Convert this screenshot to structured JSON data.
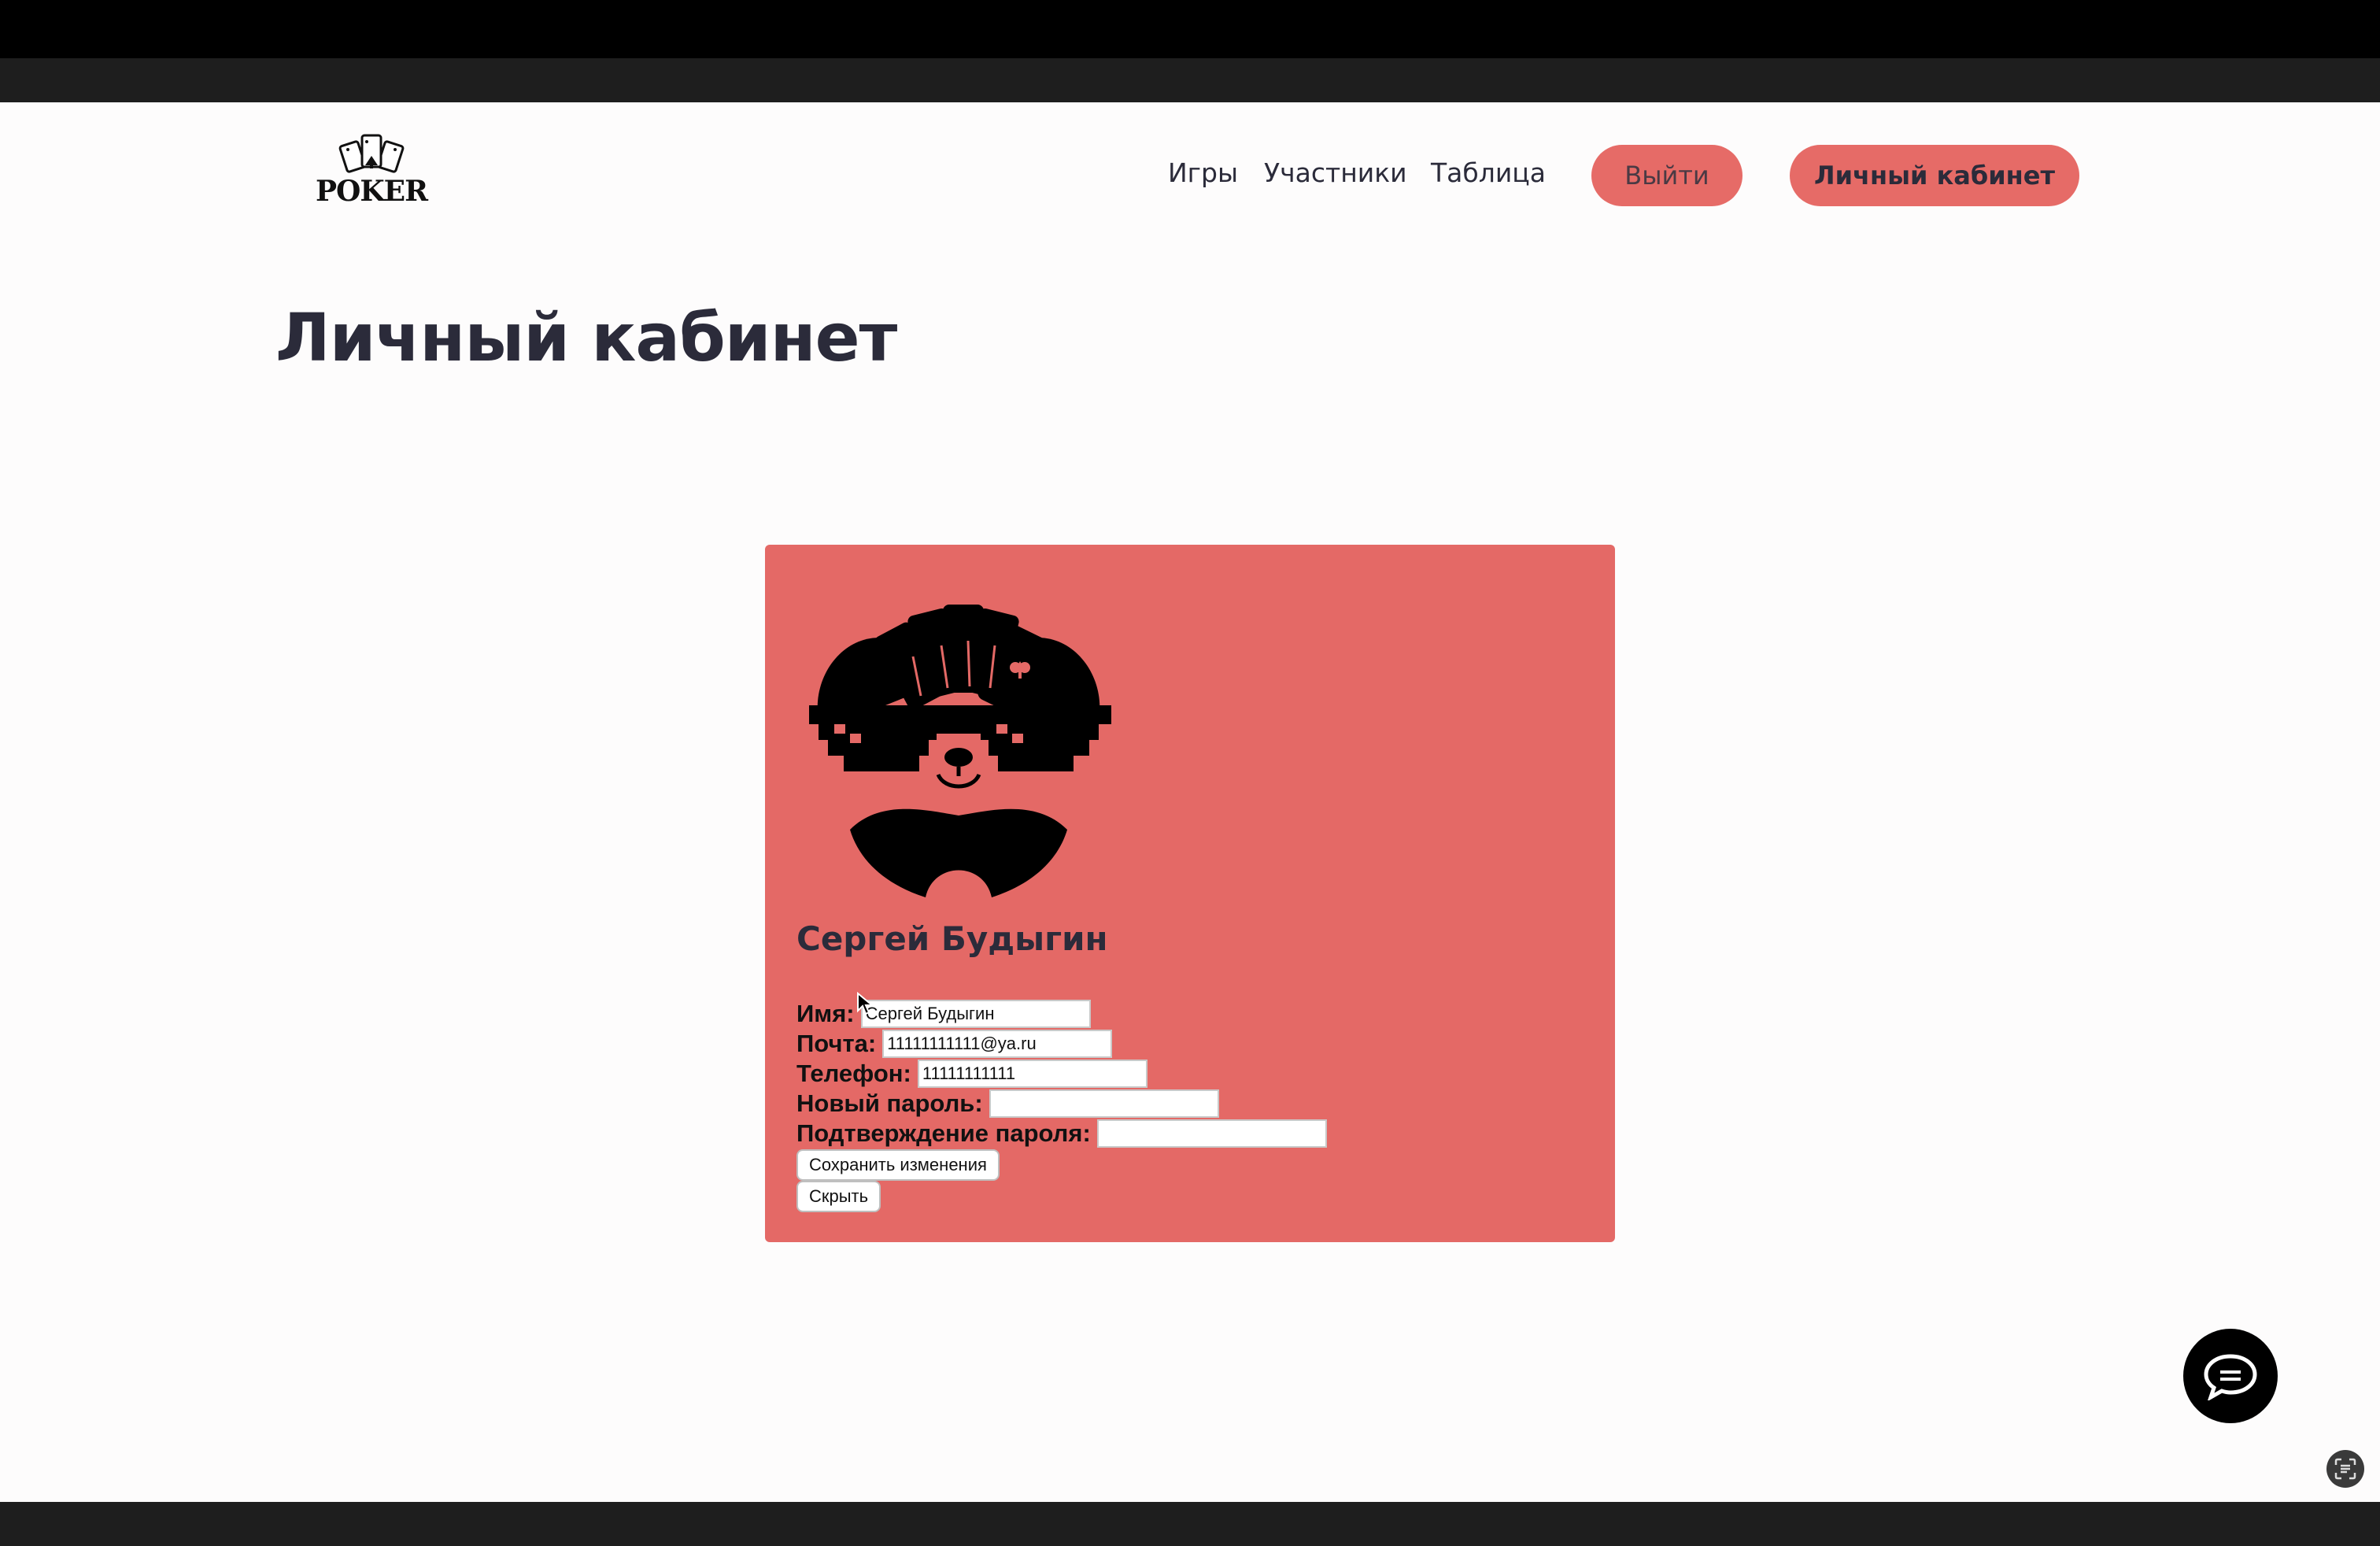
{
  "header": {
    "logo_text": "POKER",
    "nav": {
      "games": "Игры",
      "participants": "Участники",
      "table": "Таблица",
      "logout": "Выйти",
      "cabinet": "Личный кабинет"
    }
  },
  "page": {
    "title": "Личный кабинет"
  },
  "profile": {
    "display_name": "Сергей Будыгин",
    "fields": {
      "name_label": "Имя:",
      "name_value": "Сергей Будыгин",
      "email_label": "Почта:",
      "email_value": "11111111111@ya.ru",
      "phone_label": "Телефон:",
      "phone_value": "11111111111",
      "new_password_label": "Новый пароль:",
      "new_password_value": "",
      "confirm_password_label": "Подтверждение пароля:",
      "confirm_password_value": ""
    },
    "save_button": "Сохранить изменения",
    "hide_button": "Скрыть"
  },
  "icons": {
    "logo": "poker-cards-logo-icon",
    "avatar": "panda-sunglasses-cards-avatar-icon",
    "chat": "chat-bubble-icon",
    "scan": "scan-text-icon",
    "cursor": "mouse-cursor-icon"
  },
  "colors": {
    "accent": "#e66b67",
    "card": "#e46966",
    "text": "#2b2b3a",
    "bars": "#1e1e1e"
  }
}
